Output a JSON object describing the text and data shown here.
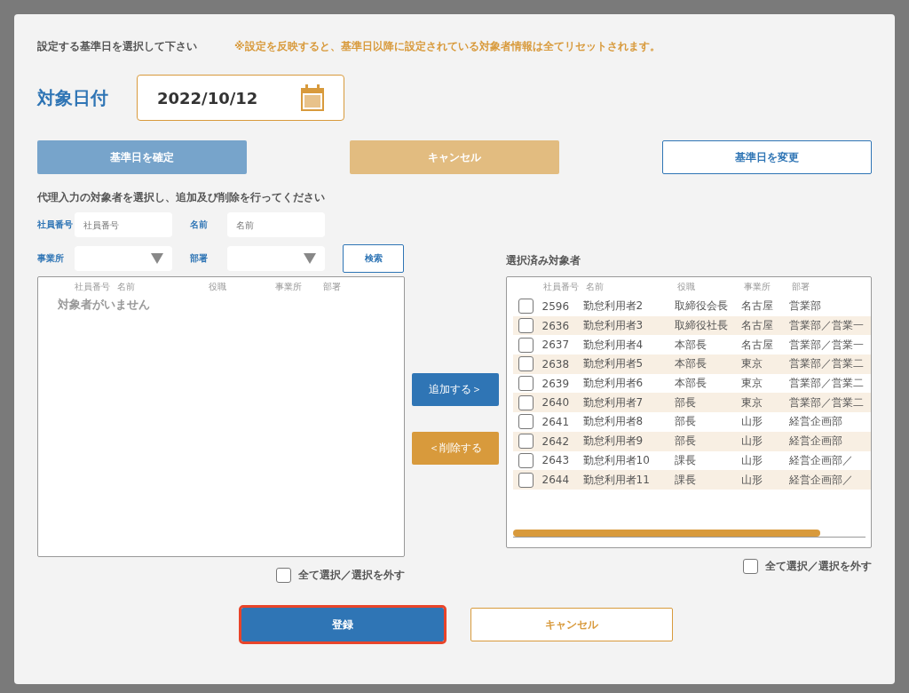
{
  "header": {
    "instruction": "設定する基準日を選択して下さい",
    "warning": "※設定を反映すると、基準日以降に設定されている対象者情報は全てリセットされます。"
  },
  "date_field": {
    "label": "対象日付",
    "value": "2022/10/12"
  },
  "date_buttons": [
    {
      "label": "基準日を確定",
      "kind": "primary",
      "disabled": true
    },
    {
      "label": "キャンセル",
      "kind": "warning",
      "disabled": true
    },
    {
      "label": "基準日を変更",
      "kind": "outline",
      "disabled": false
    }
  ],
  "select_instruction": "代理入力の対象者を選択し、追加及び削除を行ってください",
  "filters": [
    {
      "label": "社員番号",
      "kind": "text",
      "placeholder": "社員番号"
    },
    {
      "label": "名前",
      "kind": "text",
      "placeholder": "名前"
    },
    {
      "label": "事業所",
      "kind": "select"
    },
    {
      "label": "部署",
      "kind": "select"
    }
  ],
  "search_button": "検索",
  "available": {
    "columns": [
      "社員番号",
      "名前",
      "役職",
      "事業所",
      "部署"
    ],
    "empty_message": "対象者がいません",
    "select_all": {
      "label": "全て選択／選択を外す",
      "checked": false
    }
  },
  "move_buttons": [
    {
      "label": "追加する＞",
      "kind": "primary"
    },
    {
      "label": "＜削除する",
      "kind": "warning"
    }
  ],
  "selected": {
    "title": "選択済み対象者",
    "columns": [
      "社員番号",
      "名前",
      "役職",
      "事業所",
      "部署"
    ],
    "rows": [
      {
        "checked": false,
        "cells": [
          "2596",
          "勤怠利用者2",
          "取締役会長",
          "名古屋",
          "営業部"
        ]
      },
      {
        "checked": false,
        "cells": [
          "2636",
          "勤怠利用者3",
          "取締役社長",
          "名古屋",
          "営業部／営業一"
        ]
      },
      {
        "checked": false,
        "cells": [
          "2637",
          "勤怠利用者4",
          "本部長",
          "名古屋",
          "営業部／営業一"
        ]
      },
      {
        "checked": false,
        "cells": [
          "2638",
          "勤怠利用者5",
          "本部長",
          "東京",
          "営業部／営業二"
        ]
      },
      {
        "checked": false,
        "cells": [
          "2639",
          "勤怠利用者6",
          "本部長",
          "東京",
          "営業部／営業二"
        ]
      },
      {
        "checked": false,
        "cells": [
          "2640",
          "勤怠利用者7",
          "部長",
          "東京",
          "営業部／営業二"
        ]
      },
      {
        "checked": false,
        "cells": [
          "2641",
          "勤怠利用者8",
          "部長",
          "山形",
          "経営企画部"
        ]
      },
      {
        "checked": false,
        "cells": [
          "2642",
          "勤怠利用者9",
          "部長",
          "山形",
          "経営企画部"
        ]
      },
      {
        "checked": false,
        "cells": [
          "2643",
          "勤怠利用者10",
          "課長",
          "山形",
          "経営企画部／"
        ]
      },
      {
        "checked": false,
        "cells": [
          "2644",
          "勤怠利用者11",
          "課長",
          "山形",
          "経営企画部／"
        ]
      }
    ],
    "select_all": {
      "label": "全て選択／選択を外す",
      "checked": false
    }
  },
  "footer_buttons": [
    {
      "label": "登録",
      "kind": "primary",
      "highlighted": true
    },
    {
      "label": "キャンセル",
      "kind": "outline-warning",
      "highlighted": false
    }
  ]
}
